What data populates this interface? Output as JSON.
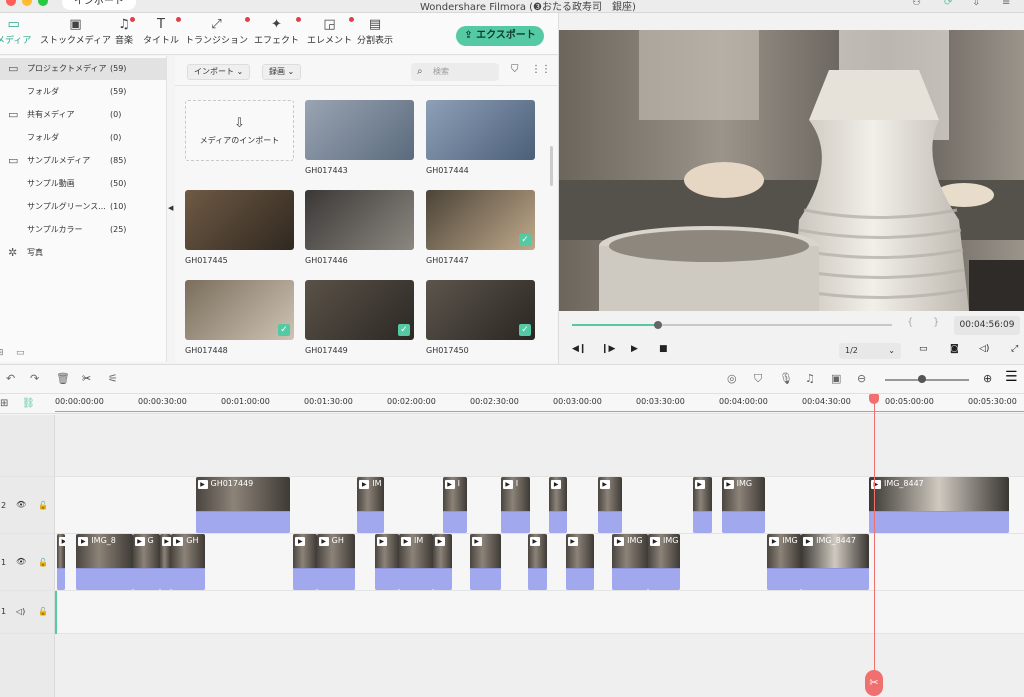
{
  "titlebar": {
    "import_tab": "インポート",
    "app_title": "Wondershare Filmora (❸おたる政寿司　銀座)",
    "colors": {
      "close": "#ff5f57",
      "minimize": "#febc2e",
      "maximize": "#28c840"
    }
  },
  "toolbar": {
    "tools": [
      {
        "label": "メディア",
        "icon": "folder-icon",
        "glyph": "▭",
        "active": true,
        "dot": false
      },
      {
        "label": "ストックメディア",
        "icon": "photo-folder-icon",
        "glyph": "▣",
        "active": false,
        "dot": false
      },
      {
        "label": "音楽",
        "icon": "music-note-icon",
        "glyph": "♫",
        "active": false,
        "dot": true
      },
      {
        "label": "タイトル",
        "icon": "title-text-icon",
        "glyph": "T",
        "active": false,
        "dot": true
      },
      {
        "label": "トランジション",
        "icon": "transition-icon",
        "glyph": "⤢",
        "active": false,
        "dot": true
      },
      {
        "label": "エフェクト",
        "icon": "effect-sparkle-icon",
        "glyph": "✦",
        "active": false,
        "dot": true
      },
      {
        "label": "エレメント",
        "icon": "element-icon",
        "glyph": "◲",
        "active": false,
        "dot": true
      },
      {
        "label": "分割表示",
        "icon": "split-screen-icon",
        "glyph": "▤",
        "active": false,
        "dot": false
      }
    ],
    "export_label": "エクスポート",
    "export_icon": "⇪"
  },
  "left_panel": {
    "items": [
      {
        "label": "プロジェクトメディア",
        "count": "(59)",
        "folder": true,
        "selected": true,
        "indent": false
      },
      {
        "label": "フォルダ",
        "count": "(59)",
        "folder": false,
        "selected": false,
        "indent": true
      },
      {
        "label": "共有メディア",
        "count": "(0)",
        "folder": true,
        "selected": false,
        "indent": false
      },
      {
        "label": "フォルダ",
        "count": "(0)",
        "folder": false,
        "selected": false,
        "indent": true
      },
      {
        "label": "サンプルメディア",
        "count": "(85)",
        "folder": true,
        "selected": false,
        "indent": false
      },
      {
        "label": "サンプル動画",
        "count": "(50)",
        "folder": false,
        "selected": false,
        "indent": true
      },
      {
        "label": "サンプルグリーンス...",
        "count": "(10)",
        "folder": false,
        "selected": false,
        "indent": true
      },
      {
        "label": "サンプルカラー",
        "count": "(25)",
        "folder": false,
        "selected": false,
        "indent": true
      },
      {
        "label": "写真",
        "count": "",
        "folder": false,
        "selected": false,
        "indent": false,
        "icon": "gear"
      }
    ]
  },
  "media_browser": {
    "import_dropdown": "インポート",
    "record_dropdown": "録画",
    "search_placeholder": "検索",
    "import_card_label": "メディアのインポート",
    "thumbnails": [
      {
        "name": "GH017443",
        "checked": false,
        "colors": [
          "#9aa4b3",
          "#5a6b7d"
        ]
      },
      {
        "name": "GH017444",
        "checked": false,
        "colors": [
          "#8da0b8",
          "#4c5f78"
        ]
      },
      {
        "name": "GH017445",
        "checked": false,
        "colors": [
          "#6f5a44",
          "#2f2820"
        ]
      },
      {
        "name": "GH017446",
        "checked": false,
        "colors": [
          "#3a3836",
          "#8c8780"
        ]
      },
      {
        "name": "GH017447",
        "checked": true,
        "colors": [
          "#4b4438",
          "#c0a98a"
        ]
      },
      {
        "name": "GH017448",
        "checked": true,
        "colors": [
          "#7a6d5c",
          "#cfc4b4"
        ]
      },
      {
        "name": "GH017449",
        "checked": true,
        "colors": [
          "#5a5248",
          "#2c2824"
        ]
      },
      {
        "name": "GH017450",
        "checked": true,
        "colors": [
          "#5c554c",
          "#2a2622"
        ]
      }
    ]
  },
  "preview": {
    "timecode": "00:04:56:09",
    "progress": 0.27,
    "ratio": "1/2",
    "bracket_left": "{",
    "bracket_right": "}"
  },
  "timeline": {
    "ruler_labels": [
      "00:00:00:00",
      "00:00:30:00",
      "00:01:00:00",
      "00:01:30:00",
      "00:02:00:00",
      "00:02:30:00",
      "00:03:00:00",
      "00:03:30:00",
      "00:04:00:00",
      "00:04:30:00",
      "00:05:00:00",
      "00:05:30:00"
    ],
    "tracks": [
      {
        "id": "video-2",
        "number": "2",
        "eye": true
      },
      {
        "id": "video-1",
        "number": "1",
        "eye": true
      },
      {
        "id": "audio-1",
        "number": "1",
        "eye": false
      }
    ],
    "video2_clips": [
      {
        "label": "GH017449",
        "start": 0.145,
        "end": 0.243
      },
      {
        "label": "IM",
        "start": 0.312,
        "end": 0.34
      },
      {
        "label": "I",
        "start": 0.4,
        "end": 0.425
      },
      {
        "label": "I",
        "start": 0.46,
        "end": 0.49
      },
      {
        "label": "",
        "start": 0.51,
        "end": 0.528
      },
      {
        "label": "",
        "start": 0.56,
        "end": 0.585
      },
      {
        "label": "",
        "start": 0.658,
        "end": 0.678
      },
      {
        "label": "IMG",
        "start": 0.688,
        "end": 0.733
      },
      {
        "label": "IMG_8447",
        "start": 0.84,
        "end": 0.985
      }
    ],
    "video1_clips": [
      {
        "label": "",
        "start": 0.002,
        "end": 0.01
      },
      {
        "label": "IMG_8",
        "start": 0.022,
        "end": 0.08
      },
      {
        "label": "G",
        "start": 0.08,
        "end": 0.108
      },
      {
        "label": "",
        "start": 0.108,
        "end": 0.12
      },
      {
        "label": "GH",
        "start": 0.12,
        "end": 0.155
      },
      {
        "label": "",
        "start": 0.246,
        "end": 0.27
      },
      {
        "label": "GH",
        "start": 0.27,
        "end": 0.31
      },
      {
        "label": "",
        "start": 0.33,
        "end": 0.355
      },
      {
        "label": "IM",
        "start": 0.355,
        "end": 0.39
      },
      {
        "label": "",
        "start": 0.39,
        "end": 0.41
      },
      {
        "label": "",
        "start": 0.428,
        "end": 0.46
      },
      {
        "label": "",
        "start": 0.488,
        "end": 0.508
      },
      {
        "label": "",
        "start": 0.527,
        "end": 0.556
      },
      {
        "label": "IMG",
        "start": 0.575,
        "end": 0.612
      },
      {
        "label": "IMG",
        "start": 0.612,
        "end": 0.645
      },
      {
        "label": "IMG",
        "start": 0.735,
        "end": 0.77
      },
      {
        "label": "IMG_8447",
        "start": 0.77,
        "end": 0.84
      }
    ],
    "colors": {
      "playhead": "#f07070",
      "clip": "#a9aef0",
      "accent": "#55c9a4"
    }
  }
}
